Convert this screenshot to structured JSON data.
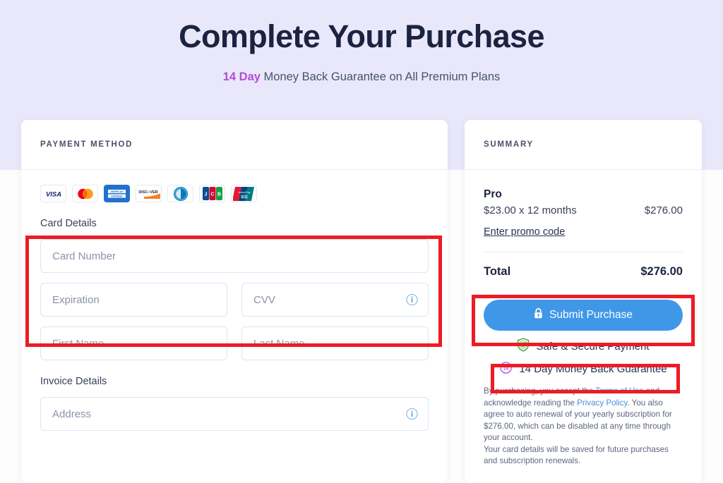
{
  "header": {
    "title": "Complete Your Purchase",
    "subtitle_accent": "14 Day",
    "subtitle_rest": " Money Back Guarantee on All Premium Plans"
  },
  "payment": {
    "section_label": "PAYMENT METHOD",
    "accepted_cards": [
      {
        "name": "visa-logo",
        "label": "VISA"
      },
      {
        "name": "mastercard-logo",
        "label": "Mastercard"
      },
      {
        "name": "amex-logo",
        "label": "AMERICAN EXPRESS"
      },
      {
        "name": "discover-logo",
        "label": "DISCOVER"
      },
      {
        "name": "diners-club-logo",
        "label": "Diners Club"
      },
      {
        "name": "jcb-logo",
        "label": "JCB"
      },
      {
        "name": "unionpay-logo",
        "label": "UnionPay"
      }
    ],
    "card_details_label": "Card Details",
    "card_number_placeholder": "Card Number",
    "expiration_placeholder": "Expiration",
    "cvv_placeholder": "CVV",
    "first_name_placeholder": "First Name",
    "last_name_placeholder": "Last Name",
    "invoice_details_label": "Invoice Details",
    "address_placeholder": "Address",
    "card_number_value": "",
    "expiration_value": "",
    "cvv_value": "",
    "first_name_value": "",
    "last_name_value": "",
    "address_value": ""
  },
  "summary": {
    "section_label": "SUMMARY",
    "plan_name": "Pro",
    "plan_terms": "$23.00 x 12 months",
    "plan_price": "$276.00",
    "promo_link": "Enter promo code",
    "total_label": "Total",
    "total_value": "$276.00",
    "submit_label": "Submit Purchase",
    "secure_badge": "Safe & Secure Payment",
    "guarantee_badge": "14 Day Money Back Guarantee",
    "guarantee_badge_days": "14",
    "legal": {
      "line1_a": "By purchasing, you accept the ",
      "terms_link": "Terms of Use",
      "line1_b": " and acknowledge reading the ",
      "privacy_link": "Privacy Policy",
      "line1_c": ". You also agree to auto renewal of your yearly subscription for $276.00, which can be disabled at any time through your account.",
      "line2": "Your card details will be saved for future purchases and subscription renewals."
    }
  },
  "colors": {
    "background_top": "#e9e8fb",
    "accent_purple": "#b44bd6",
    "button_blue": "#3f97e8",
    "link_blue": "#4a90d9",
    "annotation_red": "#ed1c24",
    "text_dark": "#1b2340"
  }
}
